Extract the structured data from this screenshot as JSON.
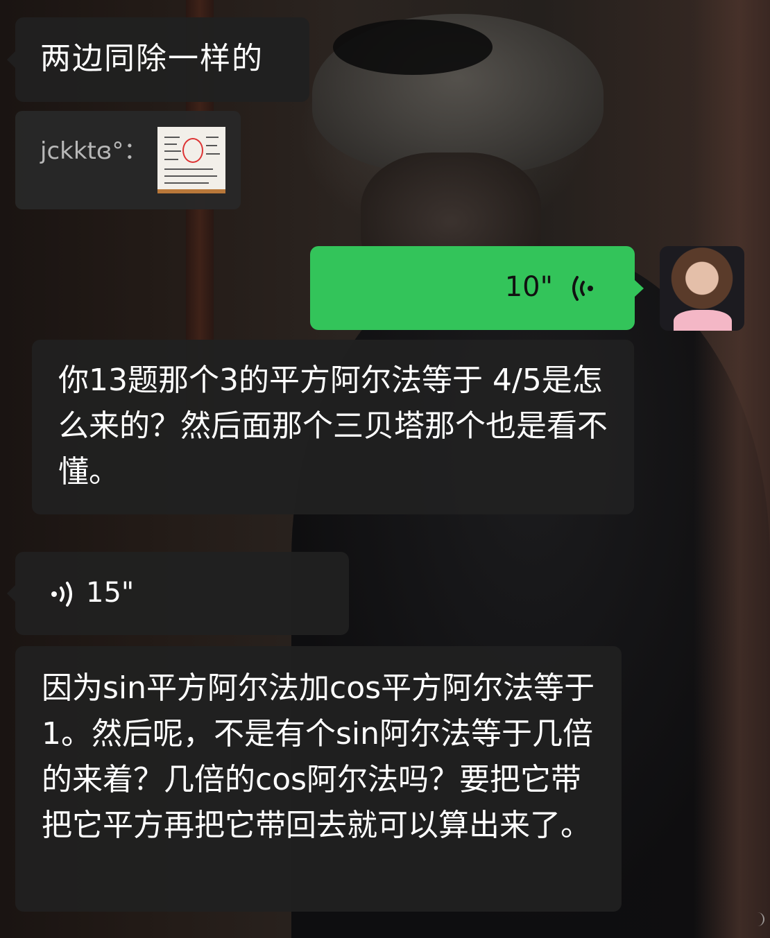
{
  "messages": [
    {
      "type": "text",
      "direction": "incoming",
      "text": "两边同除一样的"
    },
    {
      "type": "quote",
      "direction": "incoming",
      "sender": "jckktɞ°：",
      "attachment_icon": "image-thumbnail"
    },
    {
      "type": "voice",
      "direction": "outgoing",
      "duration": "10\"",
      "icon": "voice-wave-icon"
    },
    {
      "type": "text",
      "direction": "incoming",
      "text": "你13题那个3的平方阿尔法等于 4/5是怎么来的？然后面那个三贝塔那个也是看不懂。"
    },
    {
      "type": "voice",
      "direction": "incoming",
      "duration": "15\"",
      "icon": "voice-wave-icon"
    },
    {
      "type": "text",
      "direction": "incoming",
      "text": "因为sin平方阿尔法加cos平方阿尔法等于1。然后呢，不是有个sin阿尔法等于几倍的来着？几倍的cos阿尔法吗？要把它带把它平方再把它带回去就可以算出来了。"
    }
  ],
  "colors": {
    "outgoing_bubble": "#33c45a",
    "incoming_bubble": "#202020",
    "text_light": "#ffffff",
    "text_dark": "#111111",
    "quote_sender": "#b8b8b8"
  }
}
